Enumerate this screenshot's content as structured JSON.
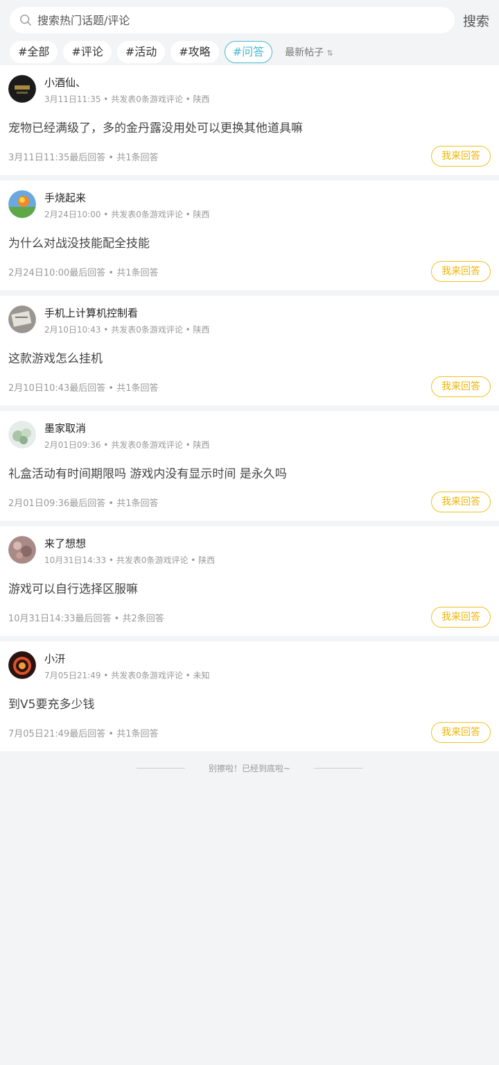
{
  "search": {
    "placeholder": "搜索热门话题/评论",
    "button_label": "搜索"
  },
  "tags": [
    {
      "label": "#全部",
      "active": false
    },
    {
      "label": "#评论",
      "active": false
    },
    {
      "label": "#活动",
      "active": false
    },
    {
      "label": "#攻略",
      "active": false
    },
    {
      "label": "#问答",
      "active": true
    }
  ],
  "sort": {
    "label": "最新帖子",
    "icon": "sort-icon"
  },
  "posts": [
    {
      "user": "小酒仙、",
      "meta": "3月11日11:35 • 共发表0条游戏评论 • 陕西",
      "question": "宠物已经满级了，多的金丹露没用处可以更换其他道具嘛",
      "foot": "3月11日11:35最后回答 • 共1条回答",
      "answer_label": "我来回答"
    },
    {
      "user": "手烧起来",
      "meta": "2月24日10:00 • 共发表0条游戏评论 • 陕西",
      "question": "为什么对战没技能配全技能",
      "foot": "2月24日10:00最后回答 • 共1条回答",
      "answer_label": "我来回答"
    },
    {
      "user": "手机上计算机控制看",
      "meta": "2月10日10:43 • 共发表0条游戏评论 • 陕西",
      "question": "这款游戏怎么挂机",
      "foot": "2月10日10:43最后回答 • 共1条回答",
      "answer_label": "我来回答"
    },
    {
      "user": "墨家取消",
      "meta": "2月01日09:36 • 共发表0条游戏评论 • 陕西",
      "question": "礼盒活动有时间期限吗 游戏内没有显示时间 是永久吗",
      "foot": "2月01日09:36最后回答 • 共1条回答",
      "answer_label": "我来回答"
    },
    {
      "user": "来了想想",
      "meta": "10月31日14:33 • 共发表0条游戏评论 • 陕西",
      "question": "游戏可以自行选择区服嘛",
      "foot": "10月31日14:33最后回答 • 共2条回答",
      "answer_label": "我来回答"
    },
    {
      "user": "小汧",
      "meta": "7月05日21:49 • 共发表0条游戏评论 • 未知",
      "question": "到V5要充多少钱",
      "foot": "7月05日21:49最后回答 • 共1条回答",
      "answer_label": "我来回答"
    }
  ],
  "end_text": "别擦啦！已经到底啦~",
  "colors": {
    "accent": "#46b8cf",
    "answer": "#f0b400",
    "background": "#f3f4f6"
  }
}
